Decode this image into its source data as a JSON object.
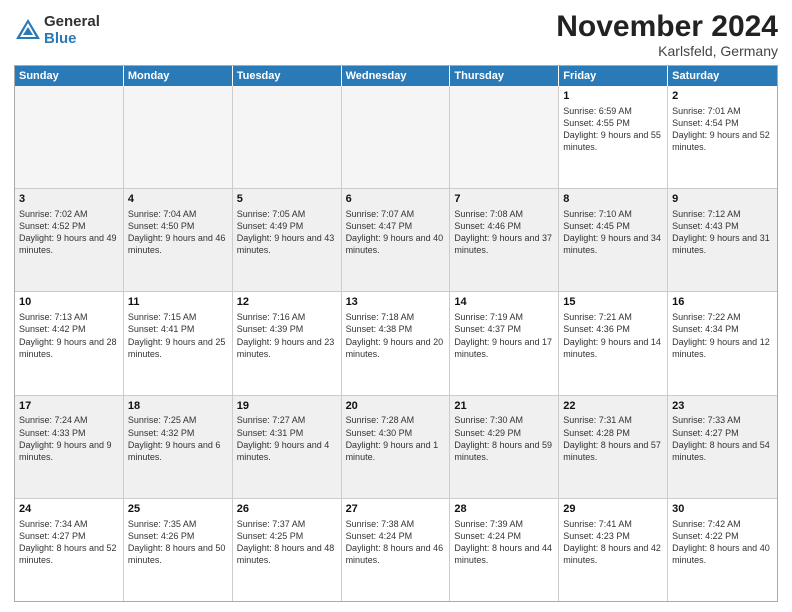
{
  "logo": {
    "general": "General",
    "blue": "Blue"
  },
  "title": "November 2024",
  "location": "Karlsfeld, Germany",
  "days": [
    "Sunday",
    "Monday",
    "Tuesday",
    "Wednesday",
    "Thursday",
    "Friday",
    "Saturday"
  ],
  "rows": [
    [
      {
        "day": "",
        "empty": true
      },
      {
        "day": "",
        "empty": true
      },
      {
        "day": "",
        "empty": true
      },
      {
        "day": "",
        "empty": true
      },
      {
        "day": "",
        "empty": true
      },
      {
        "day": "1",
        "text": "Sunrise: 6:59 AM\nSunset: 4:55 PM\nDaylight: 9 hours and 55 minutes."
      },
      {
        "day": "2",
        "text": "Sunrise: 7:01 AM\nSunset: 4:54 PM\nDaylight: 9 hours and 52 minutes."
      }
    ],
    [
      {
        "day": "3",
        "text": "Sunrise: 7:02 AM\nSunset: 4:52 PM\nDaylight: 9 hours and 49 minutes."
      },
      {
        "day": "4",
        "text": "Sunrise: 7:04 AM\nSunset: 4:50 PM\nDaylight: 9 hours and 46 minutes."
      },
      {
        "day": "5",
        "text": "Sunrise: 7:05 AM\nSunset: 4:49 PM\nDaylight: 9 hours and 43 minutes."
      },
      {
        "day": "6",
        "text": "Sunrise: 7:07 AM\nSunset: 4:47 PM\nDaylight: 9 hours and 40 minutes."
      },
      {
        "day": "7",
        "text": "Sunrise: 7:08 AM\nSunset: 4:46 PM\nDaylight: 9 hours and 37 minutes."
      },
      {
        "day": "8",
        "text": "Sunrise: 7:10 AM\nSunset: 4:45 PM\nDaylight: 9 hours and 34 minutes."
      },
      {
        "day": "9",
        "text": "Sunrise: 7:12 AM\nSunset: 4:43 PM\nDaylight: 9 hours and 31 minutes."
      }
    ],
    [
      {
        "day": "10",
        "text": "Sunrise: 7:13 AM\nSunset: 4:42 PM\nDaylight: 9 hours and 28 minutes."
      },
      {
        "day": "11",
        "text": "Sunrise: 7:15 AM\nSunset: 4:41 PM\nDaylight: 9 hours and 25 minutes."
      },
      {
        "day": "12",
        "text": "Sunrise: 7:16 AM\nSunset: 4:39 PM\nDaylight: 9 hours and 23 minutes."
      },
      {
        "day": "13",
        "text": "Sunrise: 7:18 AM\nSunset: 4:38 PM\nDaylight: 9 hours and 20 minutes."
      },
      {
        "day": "14",
        "text": "Sunrise: 7:19 AM\nSunset: 4:37 PM\nDaylight: 9 hours and 17 minutes."
      },
      {
        "day": "15",
        "text": "Sunrise: 7:21 AM\nSunset: 4:36 PM\nDaylight: 9 hours and 14 minutes."
      },
      {
        "day": "16",
        "text": "Sunrise: 7:22 AM\nSunset: 4:34 PM\nDaylight: 9 hours and 12 minutes."
      }
    ],
    [
      {
        "day": "17",
        "text": "Sunrise: 7:24 AM\nSunset: 4:33 PM\nDaylight: 9 hours and 9 minutes."
      },
      {
        "day": "18",
        "text": "Sunrise: 7:25 AM\nSunset: 4:32 PM\nDaylight: 9 hours and 6 minutes."
      },
      {
        "day": "19",
        "text": "Sunrise: 7:27 AM\nSunset: 4:31 PM\nDaylight: 9 hours and 4 minutes."
      },
      {
        "day": "20",
        "text": "Sunrise: 7:28 AM\nSunset: 4:30 PM\nDaylight: 9 hours and 1 minute."
      },
      {
        "day": "21",
        "text": "Sunrise: 7:30 AM\nSunset: 4:29 PM\nDaylight: 8 hours and 59 minutes."
      },
      {
        "day": "22",
        "text": "Sunrise: 7:31 AM\nSunset: 4:28 PM\nDaylight: 8 hours and 57 minutes."
      },
      {
        "day": "23",
        "text": "Sunrise: 7:33 AM\nSunset: 4:27 PM\nDaylight: 8 hours and 54 minutes."
      }
    ],
    [
      {
        "day": "24",
        "text": "Sunrise: 7:34 AM\nSunset: 4:27 PM\nDaylight: 8 hours and 52 minutes."
      },
      {
        "day": "25",
        "text": "Sunrise: 7:35 AM\nSunset: 4:26 PM\nDaylight: 8 hours and 50 minutes."
      },
      {
        "day": "26",
        "text": "Sunrise: 7:37 AM\nSunset: 4:25 PM\nDaylight: 8 hours and 48 minutes."
      },
      {
        "day": "27",
        "text": "Sunrise: 7:38 AM\nSunset: 4:24 PM\nDaylight: 8 hours and 46 minutes."
      },
      {
        "day": "28",
        "text": "Sunrise: 7:39 AM\nSunset: 4:24 PM\nDaylight: 8 hours and 44 minutes."
      },
      {
        "day": "29",
        "text": "Sunrise: 7:41 AM\nSunset: 4:23 PM\nDaylight: 8 hours and 42 minutes."
      },
      {
        "day": "30",
        "text": "Sunrise: 7:42 AM\nSunset: 4:22 PM\nDaylight: 8 hours and 40 minutes."
      }
    ]
  ]
}
